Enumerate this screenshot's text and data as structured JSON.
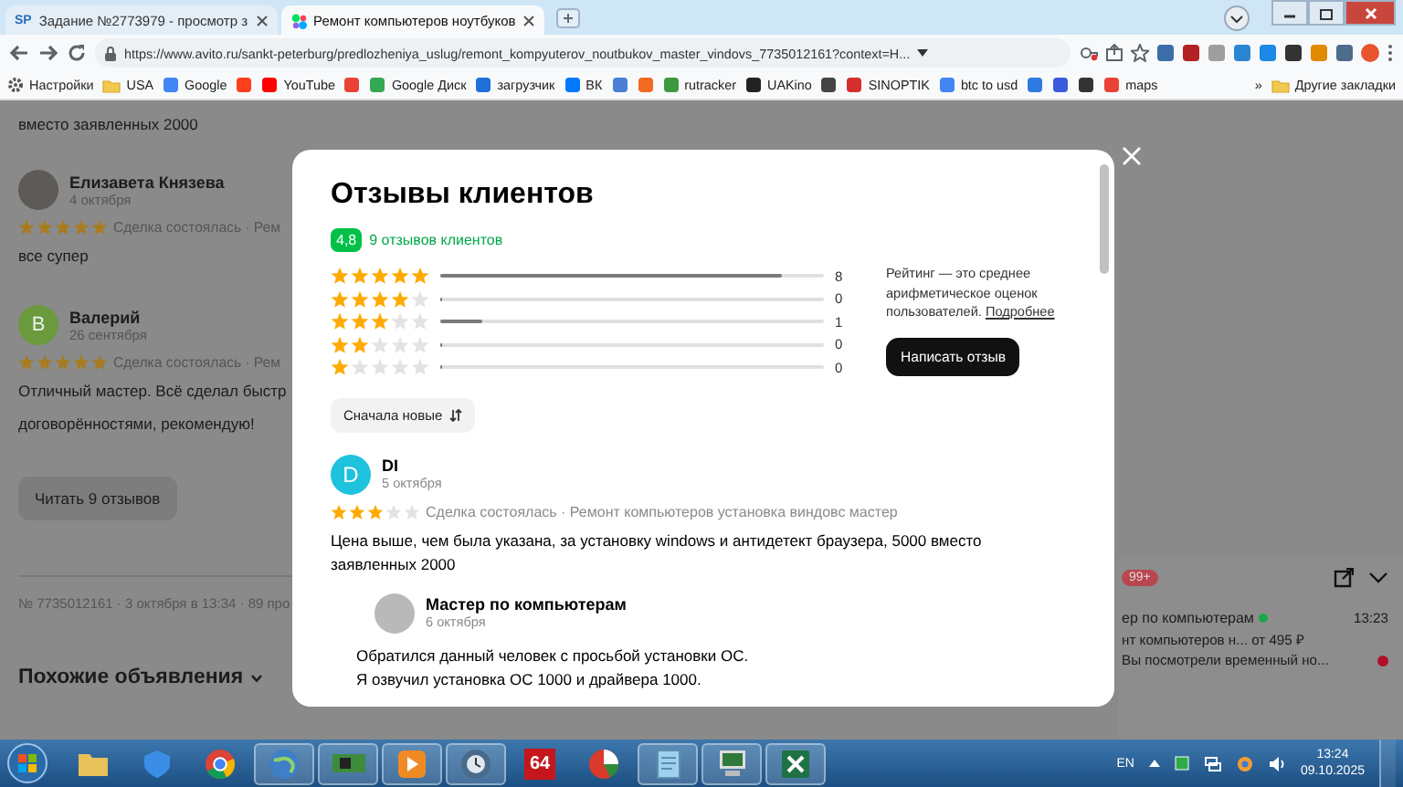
{
  "browser": {
    "tabs": [
      {
        "favicon_text": "SP",
        "title": "Задание №2773979 - просмотр з",
        "selected": false
      },
      {
        "title": "Ремонт компьютеров ноутбуков",
        "selected": true
      }
    ],
    "address": "https://www.avito.ru/sankt-peterburg/predlozheniya_uslug/remont_kompyuterov_noutbukov_master_vindovs_7735012161?context=H...",
    "bookmarks": [
      {
        "kind": "settings",
        "label": "Настройки"
      },
      {
        "kind": "folder",
        "label": "USA"
      },
      {
        "kind": "site",
        "label": "Google",
        "color": "#4285f4"
      },
      {
        "kind": "site",
        "color": "#fc3f1d"
      },
      {
        "kind": "site",
        "label": "YouTube",
        "color": "#ff0000"
      },
      {
        "kind": "site",
        "color": "#ea4335"
      },
      {
        "kind": "site",
        "label": "Google Диск",
        "color": "#34a853"
      },
      {
        "kind": "site",
        "label": "загрузчик",
        "color": "#1e6fd9"
      },
      {
        "kind": "site",
        "label": "ВК",
        "color": "#0077ff"
      },
      {
        "kind": "site",
        "color": "#4a7fd4"
      },
      {
        "kind": "site",
        "color": "#f26b21"
      },
      {
        "kind": "site",
        "label": "rutracker",
        "color": "#3c9a3c"
      },
      {
        "kind": "site",
        "label": "UAKino",
        "color": "#222222"
      },
      {
        "kind": "site",
        "color": "#444444"
      },
      {
        "kind": "site",
        "label": "SINOPTIK",
        "color": "#d62f2f"
      },
      {
        "kind": "site",
        "label": "btc to usd",
        "color": "#4285f4"
      },
      {
        "kind": "site",
        "color": "#2d7be0"
      },
      {
        "kind": "site",
        "color": "#3b5bdb"
      },
      {
        "kind": "site",
        "color": "#333333"
      },
      {
        "kind": "site",
        "label": "maps",
        "color": "#ea4335"
      },
      {
        "kind": "more",
        "label": "»"
      },
      {
        "kind": "folder",
        "label": "Другие закладки"
      }
    ]
  },
  "background_page": {
    "text_top": "вместо заявленных 2000",
    "reviews": [
      {
        "author": "Елизавета Князева",
        "date": "4 октября",
        "kind": "photo",
        "stars": 5,
        "deal": "Сделка состоялась · Рем",
        "lines": [
          "все супер"
        ]
      },
      {
        "author": "Валерий",
        "date": "26 сентября",
        "kind": "letter",
        "initial": "В",
        "color": "#6a9a3c",
        "stars": 5,
        "deal": "Сделка состоялась · Рем",
        "lines": [
          "Отличный мастер. Всё сделал быстр",
          "договорённостями, рекомендую!"
        ]
      }
    ],
    "read_button": "Читать 9 отзывов",
    "meta": "№ 7735012161 · 3 октября в 13:34 · 89 про",
    "similar": "Похожие объявления"
  },
  "modal": {
    "title": "Отзывы клиентов",
    "rating": "4,8",
    "reviews_count": "9 отзывов клиентов",
    "distribution": [
      {
        "stars": 5,
        "level": 0.89,
        "count": "8"
      },
      {
        "stars": 4,
        "level": 0,
        "count": "0"
      },
      {
        "stars": 3,
        "level": 0.11,
        "count": "1"
      },
      {
        "stars": 2,
        "level": 0,
        "count": "0"
      },
      {
        "stars": 1,
        "level": 0,
        "count": "0"
      }
    ],
    "info": "Рейтинг — это среднее арифметическое оценок пользователей.",
    "info_link": "Подробнее",
    "write_button": "Написать отзыв",
    "sort_button": "Сначала новые",
    "reviews": [
      {
        "author": "DI",
        "initial": "D",
        "color": "#1ec2dc",
        "date": "5 октября",
        "stars": 3,
        "deal": "Сделка состоялась · Ремонт компьютеров установка виндовс мастер",
        "text": "Цена выше, чем была указана, за установку windows и антидетект браузера, 5000 вместо заявленных 2000",
        "reply": {
          "author": "Мастер по компьютерам",
          "date": "6 октября",
          "lines": [
            "Обратился данный человек с просьбой установки ОС.",
            "Я озвучил установка ОС 1000 и драйвера 1000."
          ]
        }
      }
    ]
  },
  "chat": {
    "badge": "99+",
    "title": "ер по компьютерам",
    "online": true,
    "time": "13:23",
    "subtitle": "нт компьютеров н... от 495 ₽",
    "message": "Вы посмотрели временный но...",
    "unread": true
  },
  "taskbar": {
    "apps": [
      {
        "kind": "folder",
        "color": "#e8c15a",
        "running": false
      },
      {
        "kind": "shield",
        "color": "#3a8ee6",
        "running": false
      },
      {
        "kind": "chrome",
        "color": "#db4437",
        "running": false
      },
      {
        "kind": "globe",
        "color": "#3f7fc6",
        "running": true
      },
      {
        "kind": "chip",
        "color": "#3c8c3c",
        "running": true
      },
      {
        "kind": "player",
        "color": "#f08a24",
        "running": true
      },
      {
        "kind": "clock",
        "color": "#4a6a8a",
        "running": true
      },
      {
        "kind": "badge",
        "label": "64",
        "color": "#c4161c",
        "running": false
      },
      {
        "kind": "pie",
        "color": "#d93a2b",
        "running": false
      },
      {
        "kind": "note",
        "color": "#9fd0ee",
        "running": true
      },
      {
        "kind": "computer",
        "color": "#2f7a3a",
        "running": true
      },
      {
        "kind": "excel",
        "color": "#1f7244",
        "running": true
      }
    ],
    "lang": "EN",
    "time": "13:24",
    "date": "09.10.2025"
  }
}
